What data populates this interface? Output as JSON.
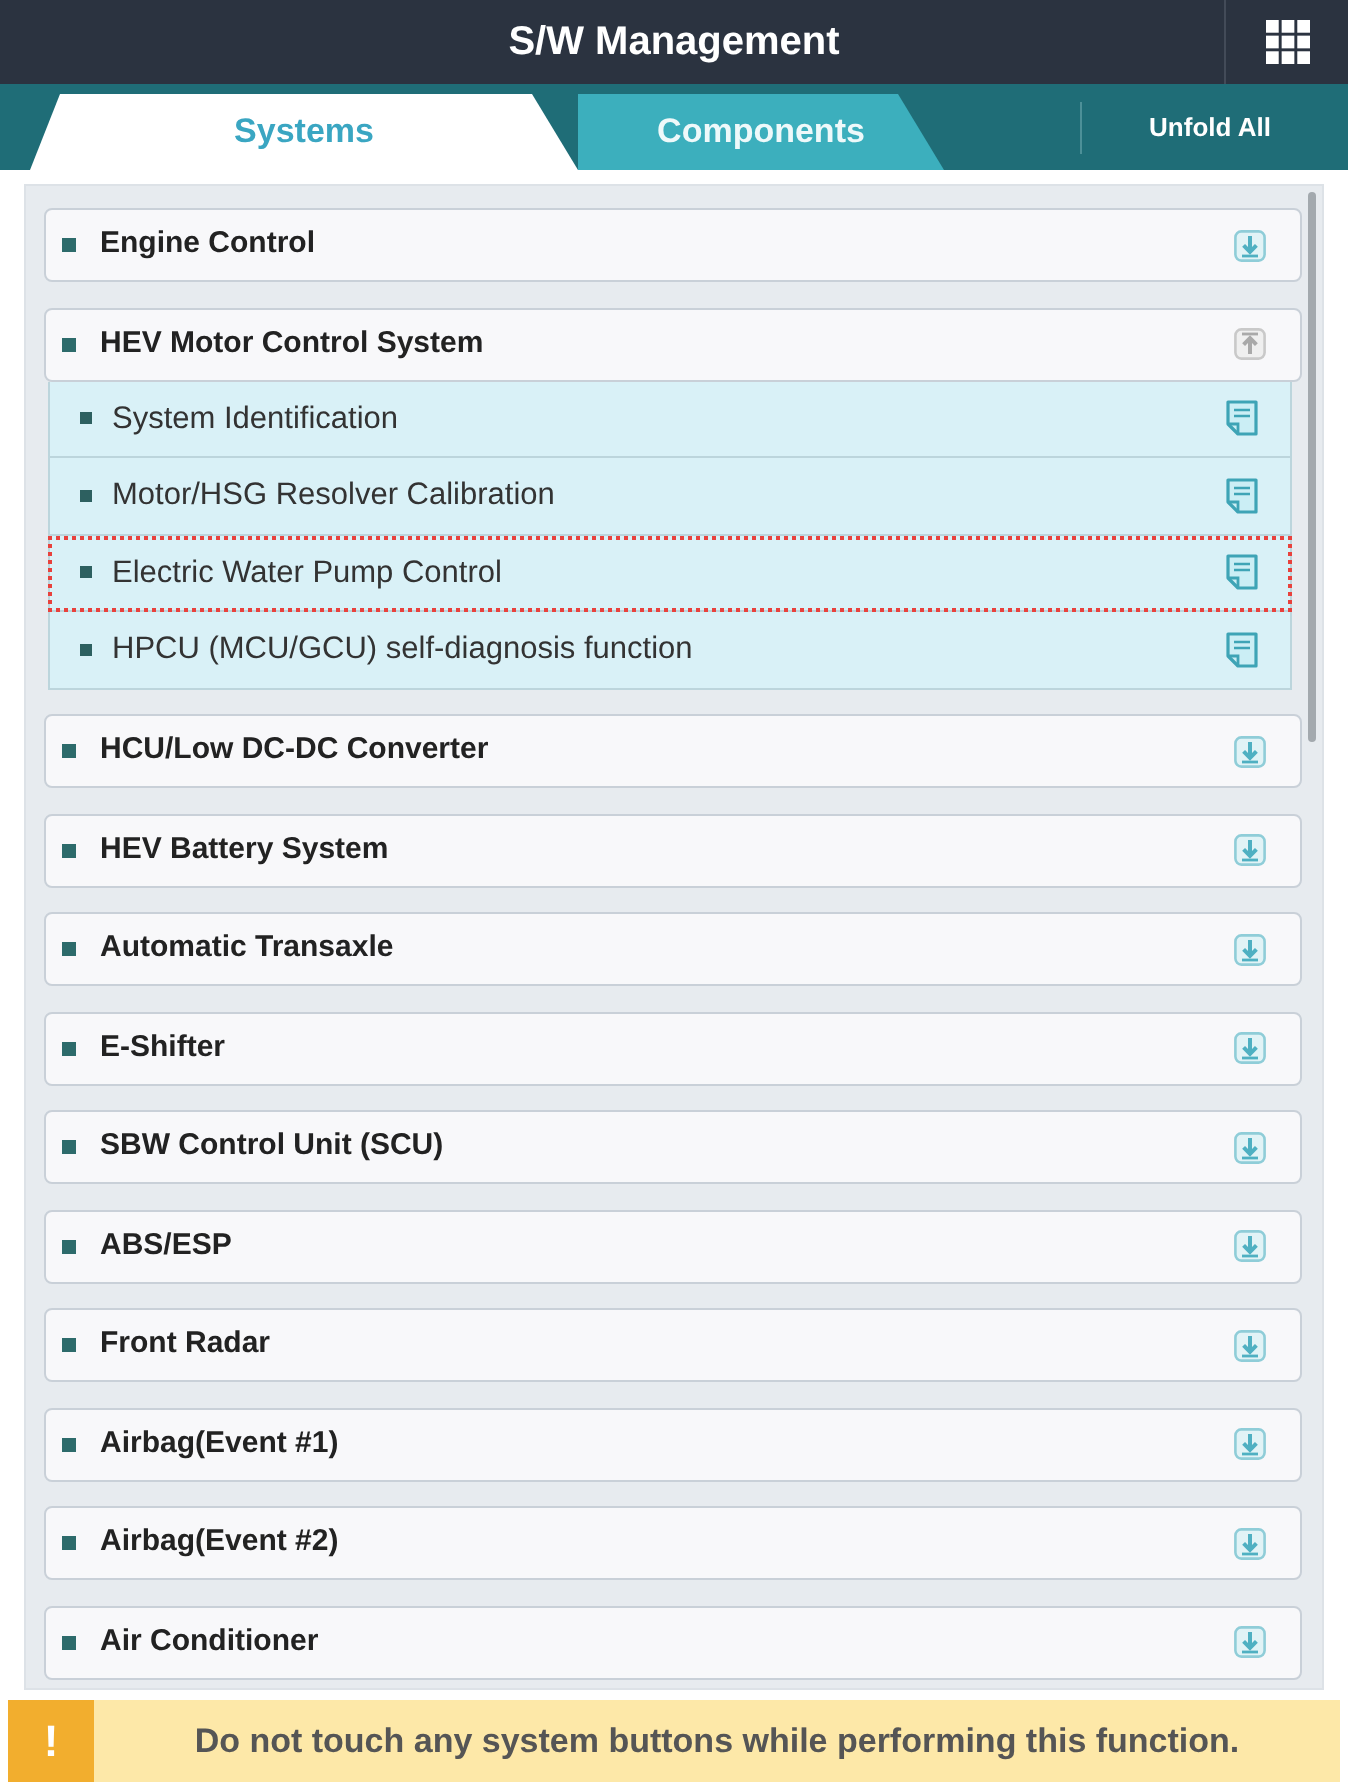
{
  "header": {
    "title": "S/W Management"
  },
  "tabs": [
    {
      "label": "Systems",
      "selected": true
    },
    {
      "label": "Components",
      "selected": false
    }
  ],
  "toolbar": {
    "unfold_all": "Unfold All"
  },
  "systems": [
    {
      "name": "Engine Control",
      "expanded": false
    },
    {
      "name": "HEV Motor Control System",
      "expanded": true,
      "children": [
        {
          "name": "System Identification",
          "selected": false
        },
        {
          "name": "Motor/HSG Resolver Calibration",
          "selected": false
        },
        {
          "name": "Electric Water Pump Control",
          "selected": true
        },
        {
          "name": "HPCU (MCU/GCU) self-diagnosis function",
          "selected": false
        }
      ]
    },
    {
      "name": "HCU/Low DC-DC Converter",
      "expanded": false
    },
    {
      "name": "HEV Battery System",
      "expanded": false
    },
    {
      "name": "Automatic Transaxle",
      "expanded": false
    },
    {
      "name": "E-Shifter",
      "expanded": false
    },
    {
      "name": "SBW Control Unit (SCU)",
      "expanded": false
    },
    {
      "name": "ABS/ESP",
      "expanded": false
    },
    {
      "name": "Front Radar",
      "expanded": false
    },
    {
      "name": "Airbag(Event #1)",
      "expanded": false
    },
    {
      "name": "Airbag(Event #2)",
      "expanded": false
    },
    {
      "name": "Air Conditioner",
      "expanded": false
    }
  ],
  "warning": {
    "icon": "!",
    "message": "Do not touch any system buttons while performing this function."
  }
}
